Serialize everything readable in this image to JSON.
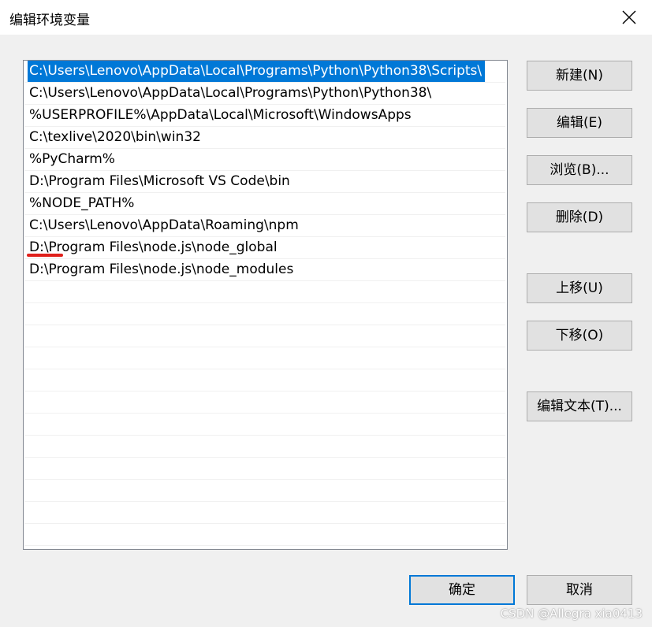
{
  "dialog": {
    "title": "编辑环境变量"
  },
  "paths": [
    "C:\\Users\\Lenovo\\AppData\\Local\\Programs\\Python\\Python38\\Scripts\\",
    "C:\\Users\\Lenovo\\AppData\\Local\\Programs\\Python\\Python38\\",
    "%USERPROFILE%\\AppData\\Local\\Microsoft\\WindowsApps",
    "C:\\texlive\\2020\\bin\\win32",
    "%PyCharm%",
    "D:\\Program Files\\Microsoft VS Code\\bin",
    "%NODE_PATH%",
    "C:\\Users\\Lenovo\\AppData\\Roaming\\npm",
    "D:\\Program Files\\node.js\\node_global",
    "D:\\Program Files\\node.js\\node_modules"
  ],
  "selected_index": 0,
  "buttons": {
    "new": "新建(N)",
    "edit": "编辑(E)",
    "browse": "浏览(B)...",
    "delete": "删除(D)",
    "move_up": "上移(U)",
    "move_down": "下移(O)",
    "edit_text": "编辑文本(T)...",
    "ok": "确定",
    "cancel": "取消"
  },
  "watermark": "CSDN @Allegra xia0413",
  "icons": {
    "close": "close-icon"
  },
  "colors": {
    "selection": "#0078d7",
    "annotation": "#e0201b"
  }
}
